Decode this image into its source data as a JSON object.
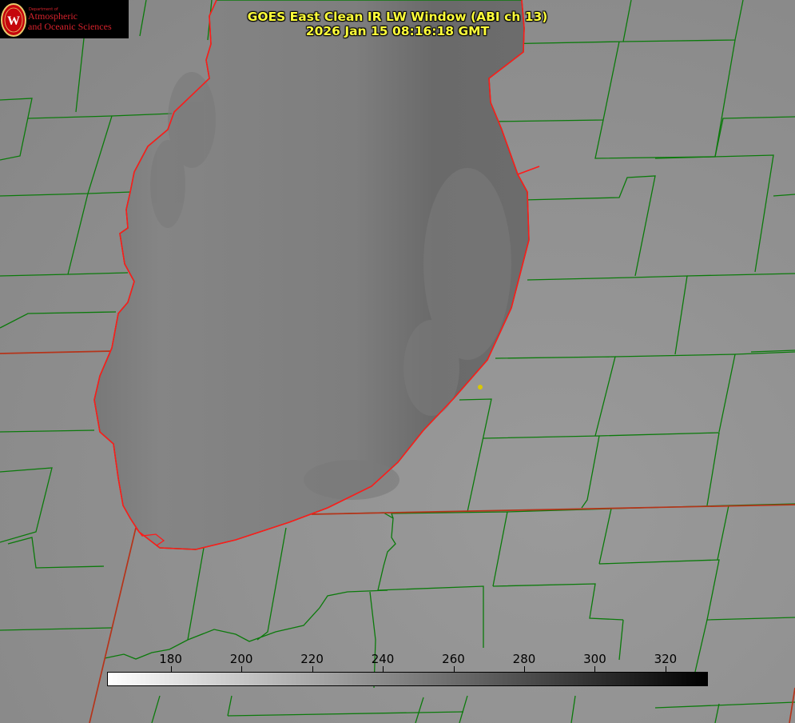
{
  "logo": {
    "department": "Department of",
    "line1": "Atmospheric",
    "line2": "and Oceanic Sciences",
    "seal_letter": "W",
    "seal_color": "#c5050c"
  },
  "title": {
    "line1": "GOES East Clean IR LW Window (ABI ch 13)",
    "line2": "2026 Jan 15 08:16:18 GMT"
  },
  "colorbar": {
    "ticks": [
      "180",
      "200",
      "220",
      "240",
      "260",
      "280",
      "300",
      "320"
    ],
    "range": [
      162,
      332
    ],
    "gradient": "white-to-black"
  },
  "colors": {
    "county_lines": "#0b7a0b",
    "state_lines": "#b5341a",
    "coastline": "#ff1a1a",
    "title_text": "#ffff3a",
    "station": "#d9c800"
  },
  "map": {
    "feature": "lake",
    "legend": "none"
  }
}
